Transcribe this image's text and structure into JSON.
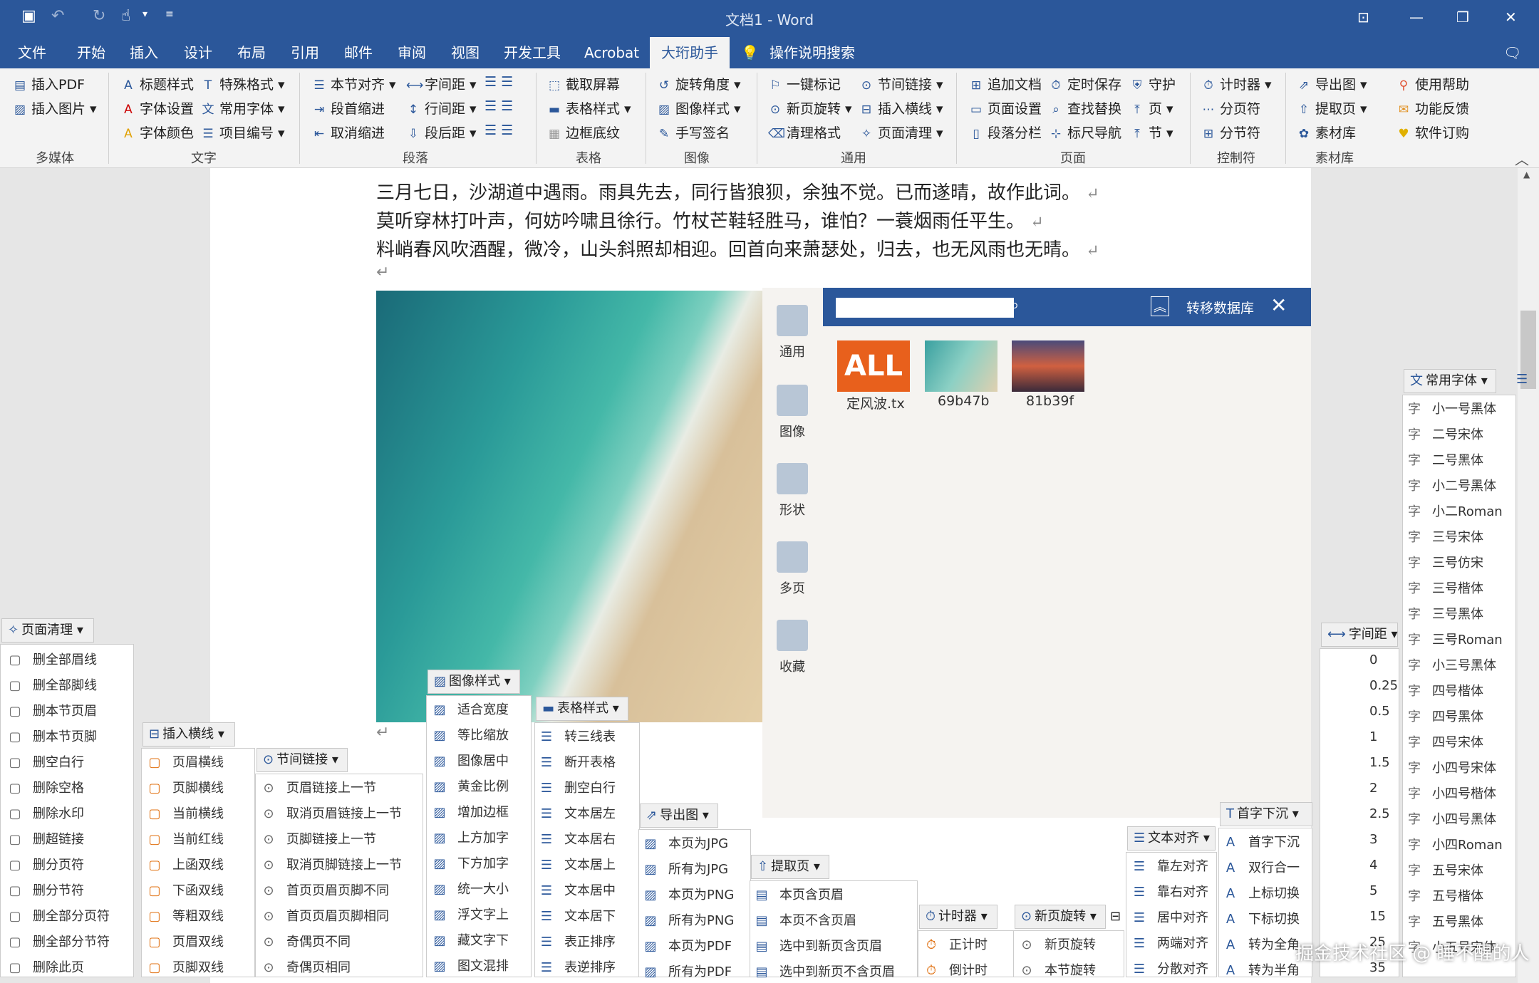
{
  "title_bar": {
    "title": "文档1 - Word",
    "quick_access": [
      "save-icon",
      "undo-icon",
      "redo-icon",
      "touch-icon"
    ]
  },
  "tabs": [
    "文件",
    "开始",
    "插入",
    "设计",
    "布局",
    "引用",
    "邮件",
    "审阅",
    "视图",
    "开发工具",
    "Acrobat",
    "大珩助手",
    "操作说明搜索"
  ],
  "ribbon": {
    "media": {
      "items": [
        "插入PDF",
        "插入图片"
      ],
      "label": "多媒体"
    },
    "text": {
      "items": [
        "标题样式",
        "特殊格式",
        "字体设置",
        "常用字体",
        "字体颜色",
        "项目编号"
      ],
      "label": "文字"
    },
    "paragraph": {
      "items": [
        "本节对齐",
        "字间距",
        "段首缩进",
        "行间距",
        "取消缩进",
        "段后距"
      ],
      "label": "段落"
    },
    "table": {
      "items": [
        "截取屏幕",
        "表格样式",
        "边框底纹"
      ],
      "label": "表格"
    },
    "image": {
      "items": [
        "旋转角度",
        "图像样式",
        "手写签名"
      ],
      "label": "图像"
    },
    "general": {
      "items": [
        "一键标记",
        "节间链接",
        "新页旋转",
        "插入横线",
        "清理格式",
        "页面清理"
      ],
      "label": "通用"
    },
    "page": {
      "items": [
        "追加文档",
        "定时保存",
        "守护",
        "页面设置",
        "查找替换",
        "页",
        "段落分栏",
        "标尺导航",
        "节"
      ],
      "label": "页面"
    },
    "control": {
      "items": [
        "计时器",
        "分页符",
        "分节符"
      ],
      "label": "控制符"
    },
    "material": {
      "items": [
        "导出图",
        "提取页",
        "素材库",
        "使用帮助",
        "功能反馈",
        "软件订购"
      ],
      "label": "素材库"
    }
  },
  "document": {
    "lines": [
      "三月七日，沙湖道中遇雨。雨具先去，同行皆狼狈，余独不觉。已而遂晴，故作此词。",
      "莫听穿林打叶声，何妨吟啸且徐行。竹杖芒鞋轻胜马，谁怕？一蓑烟雨任平生。",
      "料峭春风吹酒醒，微冷，山头斜照却相迎。回首向来萧瑟处，归去，也无风雨也无晴。"
    ],
    "para_mark": "↵"
  },
  "material_panel": {
    "title": "转移数据库",
    "search_placeholder": "",
    "categories": [
      "通用",
      "图像",
      "形状",
      "多页",
      "收藏"
    ],
    "thumbs": [
      {
        "label": "定风波.tx",
        "badge": "ALL"
      },
      {
        "label": "69b47b"
      },
      {
        "label": "81b39f"
      }
    ]
  },
  "menus": {
    "page_clean": {
      "title": "页面清理",
      "items": [
        "删全部眉线",
        "删全部脚线",
        "删本节页眉",
        "删本节页脚",
        "删空白行",
        "删除空格",
        "删除水印",
        "删超链接",
        "删分页符",
        "删分节符",
        "删全部分页符",
        "删全部分节符",
        "删除此页"
      ]
    },
    "insert_line": {
      "title": "插入横线",
      "items": [
        "页眉横线",
        "页脚横线",
        "当前横线",
        "当前红线",
        "上函双线",
        "下函双线",
        "等粗双线",
        "页眉双线",
        "页脚双线"
      ]
    },
    "section_link": {
      "title": "节间链接",
      "items": [
        "页眉链接上一节",
        "取消页眉链接上一节",
        "页脚链接上一节",
        "取消页脚链接上一节",
        "首页页眉页脚不同",
        "首页页眉页脚相同",
        "奇偶页不同",
        "奇偶页相同"
      ]
    },
    "image_style": {
      "title": "图像样式",
      "items": [
        "适合宽度",
        "等比缩放",
        "图像居中",
        "黄金比例",
        "增加边框",
        "上方加字",
        "下方加字",
        "统一大小",
        "浮文字上",
        "藏文字下",
        "图文混排"
      ]
    },
    "table_style": {
      "title": "表格样式",
      "items": [
        "转三线表",
        "断开表格",
        "删空白行",
        "文本居左",
        "文本居右",
        "文本居上",
        "文本居中",
        "文本居下",
        "表正排序",
        "表逆排序"
      ]
    },
    "export_image": {
      "title": "导出图",
      "items": [
        "本页为JPG",
        "所有为JPG",
        "本页为PNG",
        "所有为PNG",
        "本页为PDF",
        "所有为PDF"
      ]
    },
    "extract_page": {
      "title": "提取页",
      "items": [
        "本页含页眉",
        "本页不含页眉",
        "选中到新页含页眉",
        "选中到新页不含页眉"
      ]
    },
    "timer": {
      "title": "计时器",
      "items": [
        "正计时",
        "倒计时"
      ]
    },
    "new_page_rotate": {
      "title": "新页旋转",
      "items": [
        "新页旋转",
        "本节旋转"
      ]
    },
    "text_align": {
      "title": "文本对齐",
      "items": [
        "靠左对齐",
        "靠右对齐",
        "居中对齐",
        "两端对齐",
        "分散对齐"
      ]
    },
    "first_indent": {
      "title": "首字下沉",
      "items": [
        "首字下沉",
        "双行合一",
        "上标切换",
        "下标切换",
        "转为全角",
        "转为半角"
      ]
    },
    "char_spacing": {
      "title": "字间距",
      "items": [
        "0",
        "0.25",
        "0.5",
        "1",
        "1.5",
        "2",
        "2.5",
        "3",
        "4",
        "5",
        "15",
        "25",
        "35"
      ]
    },
    "common_fonts": {
      "title": "常用字体",
      "glyph": "字",
      "items": [
        "小一号黑体",
        "二号宋体",
        "二号黑体",
        "小二号黑体",
        "小二Roman",
        "三号宋体",
        "三号仿宋",
        "三号楷体",
        "三号黑体",
        "三号Roman",
        "小三号黑体",
        "四号楷体",
        "四号黑体",
        "四号宋体",
        "小四号宋体",
        "小四号楷体",
        "小四号黑体",
        "小四Roman",
        "五号宋体",
        "五号楷体",
        "五号黑体",
        "小五号宋体"
      ]
    }
  },
  "watermark": "掘金技术社区 @ 睡不醒的人"
}
